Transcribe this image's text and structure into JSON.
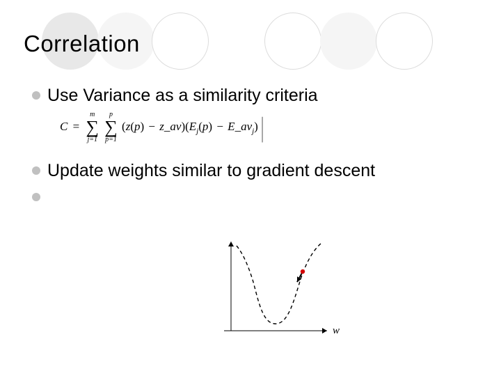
{
  "title": "Correlation",
  "bullets": {
    "b1": "Use  Variance as a similarity criteria",
    "b2": "Update weights similar to gradient descent"
  },
  "formula": {
    "lhs": "C",
    "eq": "=",
    "sum1_top": "m",
    "sum1_bot": "j=1",
    "sum2_top": "p",
    "sum2_bot": "p=1",
    "term1_a": "z",
    "term1_p": "p",
    "term1_b": "z",
    "term1_av": "av",
    "term2_a": "E",
    "term2_j": "j",
    "term2_p": "p",
    "term2_b": "E",
    "term2_av": "av",
    "term2_jj": "j"
  },
  "diagram": {
    "w_label": "w"
  }
}
